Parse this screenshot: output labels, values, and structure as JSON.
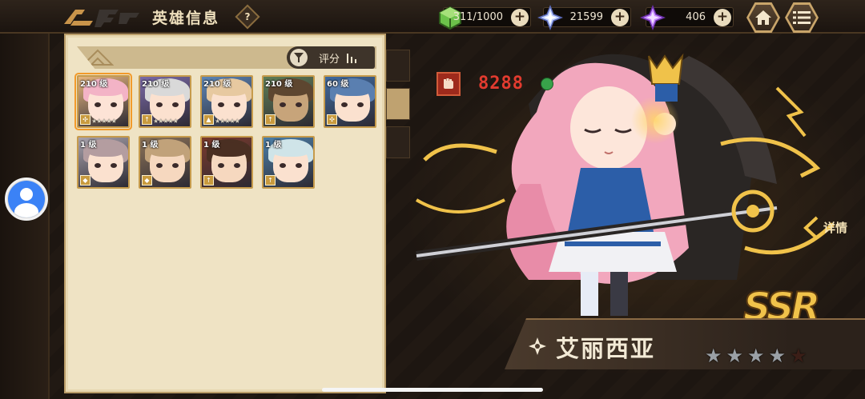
{
  "header": {
    "title": "英雄信息",
    "help_label": "?"
  },
  "resources": [
    {
      "icon": "stamina-cube-icon",
      "value": "311/1000",
      "plus": "+",
      "color": "#6cc24a"
    },
    {
      "icon": "crystal-icon",
      "value": "21599",
      "plus": "+",
      "color": "#b9c9ff"
    },
    {
      "icon": "diamond-icon",
      "value": "406",
      "plus": "+",
      "color": "#c78bff"
    }
  ],
  "nav": {
    "home_icon": "home-icon",
    "menu_icon": "menu-list-icon"
  },
  "panel": {
    "sort_label": "评分",
    "heroes": [
      {
        "level": "210 级",
        "cls": "✣",
        "hair": "#f3b3c6",
        "skin": "#fde3d6",
        "bg": "#e6b67f",
        "selected": true
      },
      {
        "level": "210 级",
        "cls": "↑",
        "hair": "#d9d9d9",
        "skin": "#fbe1cf",
        "bg": "#7b6aa8",
        "selected": false
      },
      {
        "level": "210 级",
        "cls": "▲",
        "hair": "#e7c9a0",
        "skin": "#fbe1cf",
        "bg": "#5d86b7",
        "selected": false
      },
      {
        "level": "210 级",
        "cls": "↑",
        "hair": "#5d4630",
        "skin": "#c7a47a",
        "bg": "#5f7d56",
        "selected": false
      },
      {
        "level": "60 级",
        "cls": "✣",
        "hair": "#5a7fb0",
        "skin": "#fbe1cf",
        "bg": "#3f6aa0",
        "selected": false
      },
      {
        "level": "1 级",
        "cls": "◆",
        "hair": "#b49da0",
        "skin": "#fbe1cf",
        "bg": "#a9a3ad",
        "selected": false
      },
      {
        "level": "1 级",
        "cls": "◆",
        "hair": "#c1a27a",
        "skin": "#f6d8bf",
        "bg": "#8c7358",
        "selected": false
      },
      {
        "level": "1 级",
        "cls": "↑",
        "hair": "#4a2f22",
        "skin": "#f6d8bf",
        "bg": "#7a3a2c",
        "selected": false
      },
      {
        "level": "1 级",
        "cls": "↑",
        "hair": "#cfe4e8",
        "skin": "#fbe1cf",
        "bg": "#4c7fa8",
        "selected": false
      }
    ]
  },
  "hero": {
    "power": "8288",
    "detail_label": "详情",
    "rarity": "SSR",
    "name": "艾丽西亚",
    "stars_filled": 4,
    "stars_total": 5
  }
}
